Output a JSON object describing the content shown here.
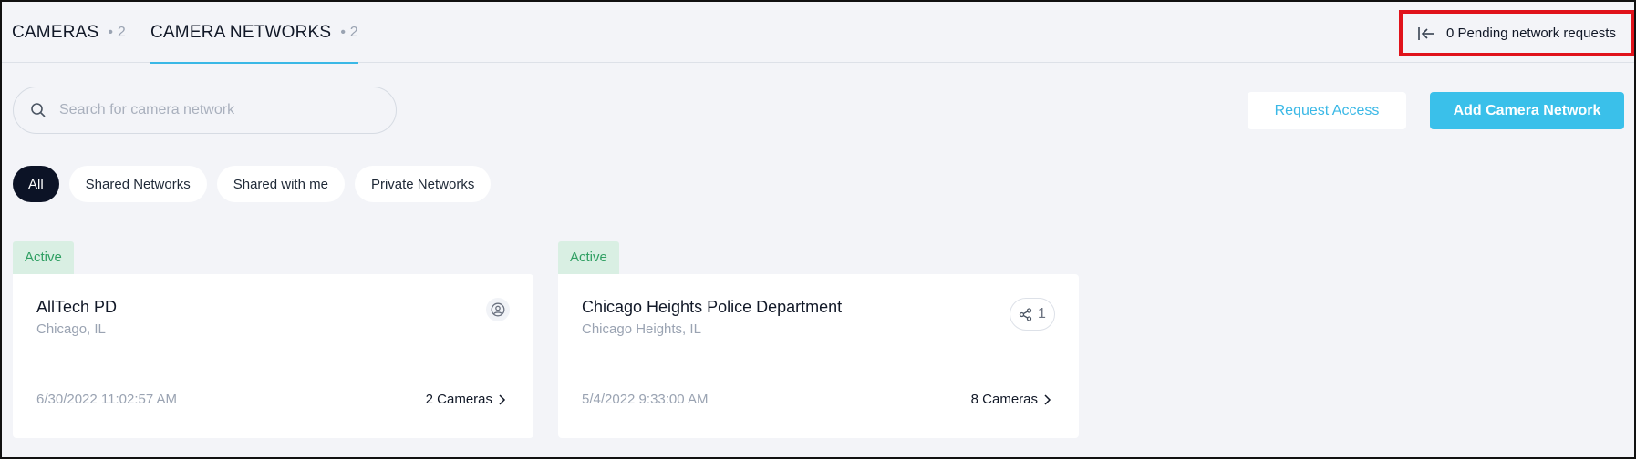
{
  "tabs": [
    {
      "label": "CAMERAS",
      "count": "• 2"
    },
    {
      "label": "CAMERA NETWORKS",
      "count": "• 2"
    }
  ],
  "pending": {
    "label": "0 Pending network requests",
    "icon": "arrow-to-left-icon"
  },
  "search": {
    "placeholder": "Search for camera network",
    "value": ""
  },
  "actions": {
    "request_access": "Request Access",
    "add_network": "Add Camera Network"
  },
  "filters": [
    "All",
    "Shared Networks",
    "Shared with me",
    "Private Networks"
  ],
  "cards": [
    {
      "status": "Active",
      "name": "AllTech PD",
      "location": "Chicago, IL",
      "date": "6/30/2022 11:02:57 AM",
      "cameras": "2 Cameras",
      "icon": "user-circle-icon"
    },
    {
      "status": "Active",
      "name": "Chicago Heights Police Department",
      "location": "Chicago Heights, IL",
      "date": "5/4/2022 9:33:00 AM",
      "cameras": "8 Cameras",
      "icon": "share-icon",
      "share_count": "1"
    }
  ],
  "colors": {
    "accent": "#3ac0ea",
    "active_badge_bg": "#d9efe3",
    "active_badge_text": "#2f9f62",
    "highlight": "#e0131b"
  }
}
